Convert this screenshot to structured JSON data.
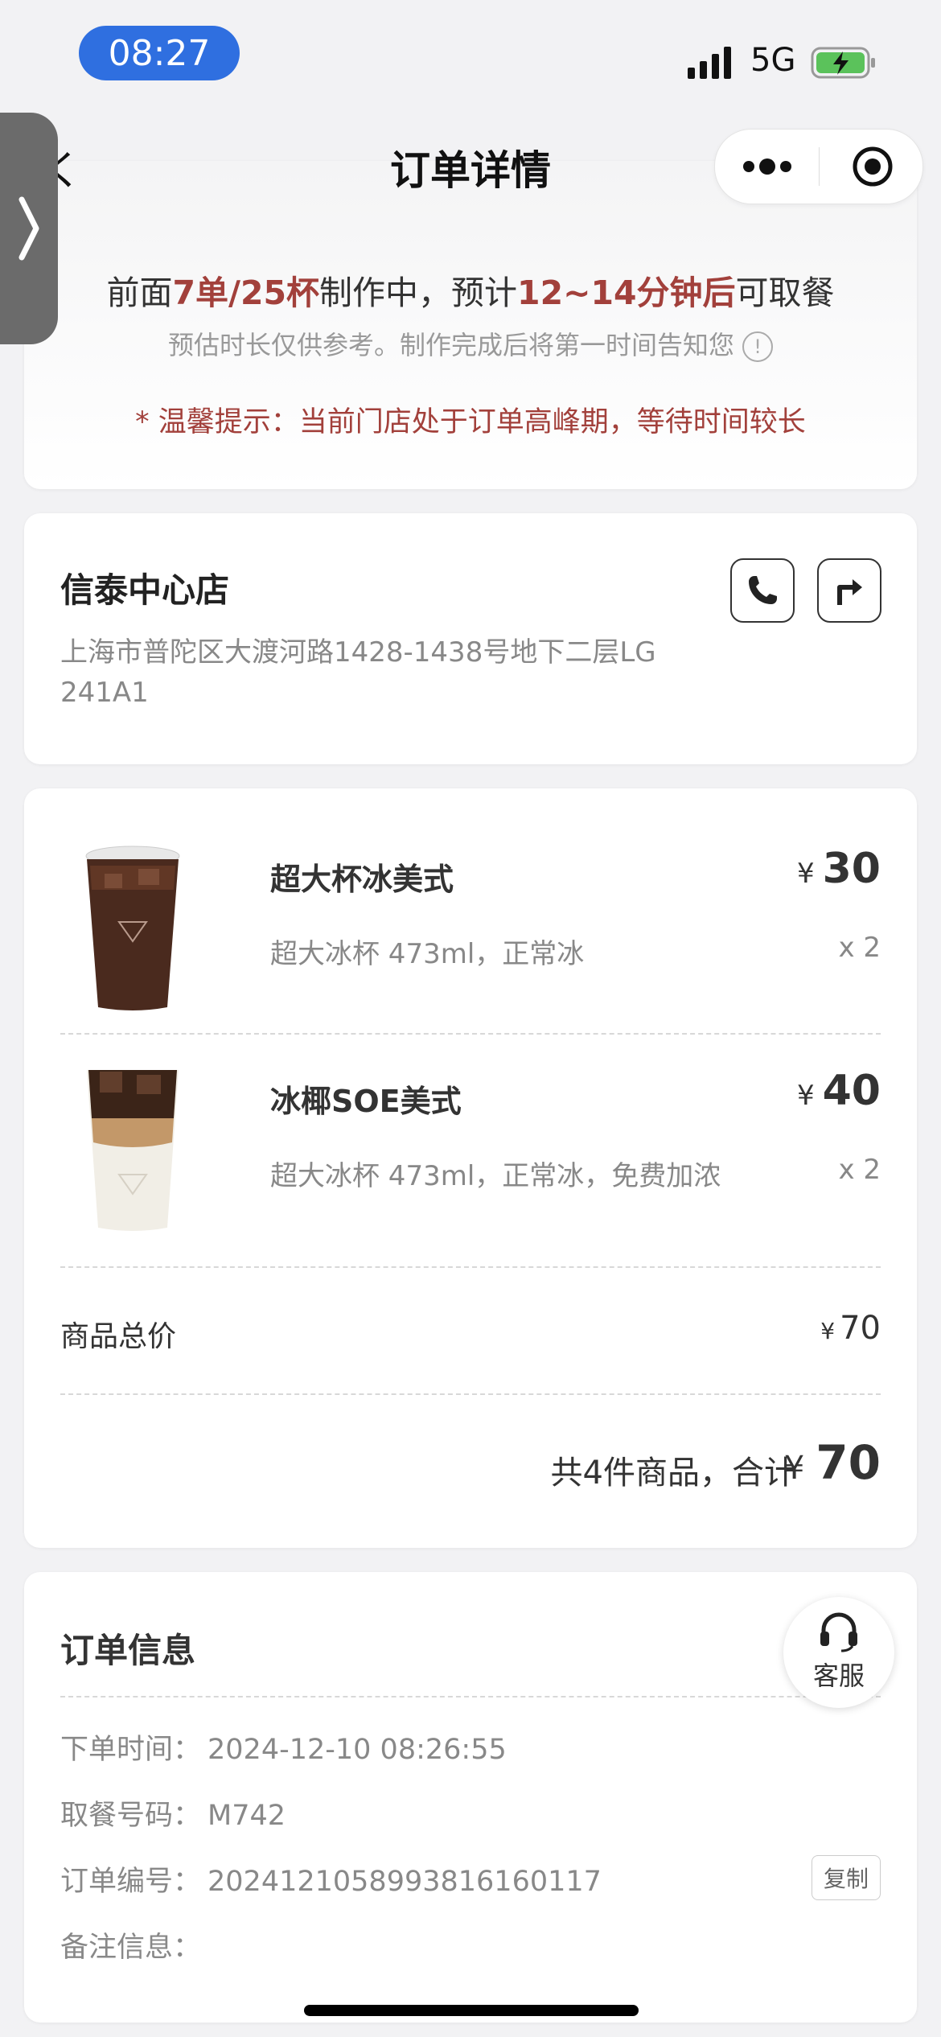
{
  "status_bar": {
    "time": "08:27",
    "network": "5G"
  },
  "nav": {
    "title": "订单详情",
    "back_partial": "く"
  },
  "queue": {
    "prefix": "前面",
    "queue_count": "7单/25杯",
    "middle": "制作中，预计",
    "wait_time": "12~14分钟后",
    "suffix": "可取餐",
    "note": "预估时长仅供参考。制作完成后将第一时间告知您",
    "info_glyph": "!",
    "tip": "* 温馨提示：当前门店处于订单高峰期，等待时间较长"
  },
  "store": {
    "name": "信泰中心店",
    "address": "上海市普陀区大渡河路1428-1438号地下二层LG 241A1"
  },
  "items": [
    {
      "name": "超大杯冰美式",
      "spec": "超大冰杯 473ml，正常冰",
      "currency": "¥",
      "price": "30",
      "qty": "x 2"
    },
    {
      "name": "冰椰SOE美式",
      "spec": "超大冰杯 473ml，正常冰，免费加浓",
      "currency": "¥",
      "price": "40",
      "qty": "x 2"
    }
  ],
  "summary": {
    "goods_label": "商品总价",
    "goods_currency": "¥",
    "goods_value": "70",
    "total_text": "共4件商品，合计",
    "total_currency": "¥",
    "total_value": "70"
  },
  "order_info": {
    "title": "订单信息",
    "rows": [
      {
        "label": "下单时间：",
        "value": "2024-12-10 08:26:55"
      },
      {
        "label": "取餐号码：",
        "value": "M742"
      },
      {
        "label": "订单编号：",
        "value": "20241210589938161601​17"
      },
      {
        "label": "备注信息：",
        "value": ""
      }
    ],
    "copy_label": "复制"
  },
  "service": {
    "label": "客服"
  },
  "colors": {
    "accent_red": "#a2403b",
    "time_pill": "#2f6fe0"
  },
  "icons": [
    "signal-icon",
    "battery-charging-icon",
    "more-icon",
    "record-target-icon",
    "expand-chevron-icon",
    "phone-icon",
    "directions-icon",
    "info-icon",
    "headset-icon"
  ]
}
